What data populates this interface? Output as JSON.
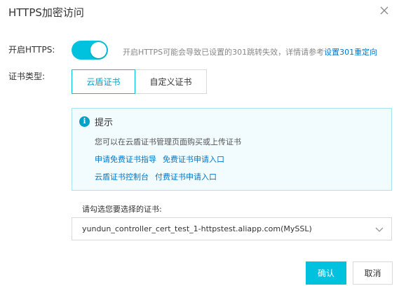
{
  "dialog": {
    "title": "HTTPS加密访问"
  },
  "https": {
    "label": "开启HTTPS:",
    "enabled": true,
    "hint_text": "开启HTTPS可能会导致已设置的301跳转失效，详情请参考",
    "hint_link": "设置301重定向"
  },
  "cert_type": {
    "label": "证书类型:",
    "options": [
      "云盾证书",
      "自定义证书"
    ],
    "selected": "云盾证书"
  },
  "tip": {
    "title": "提示",
    "description": "您可以在云盾证书管理页面购买或上传证书",
    "links_row1": [
      "申请免费证书指导",
      "免费证书申请入口"
    ],
    "links_row2": [
      "云盾证书控制台",
      "付费证书申请入口"
    ]
  },
  "cert_select": {
    "label": "请勾选您要选择的证书:",
    "value": "yundun_controller_cert_test_1-httpstest.aliapp.com(MySSL)"
  },
  "footer": {
    "confirm_label": "确认",
    "cancel_label": "取消"
  },
  "colors": {
    "accent": "#00c1de",
    "link": "#0077cc"
  }
}
